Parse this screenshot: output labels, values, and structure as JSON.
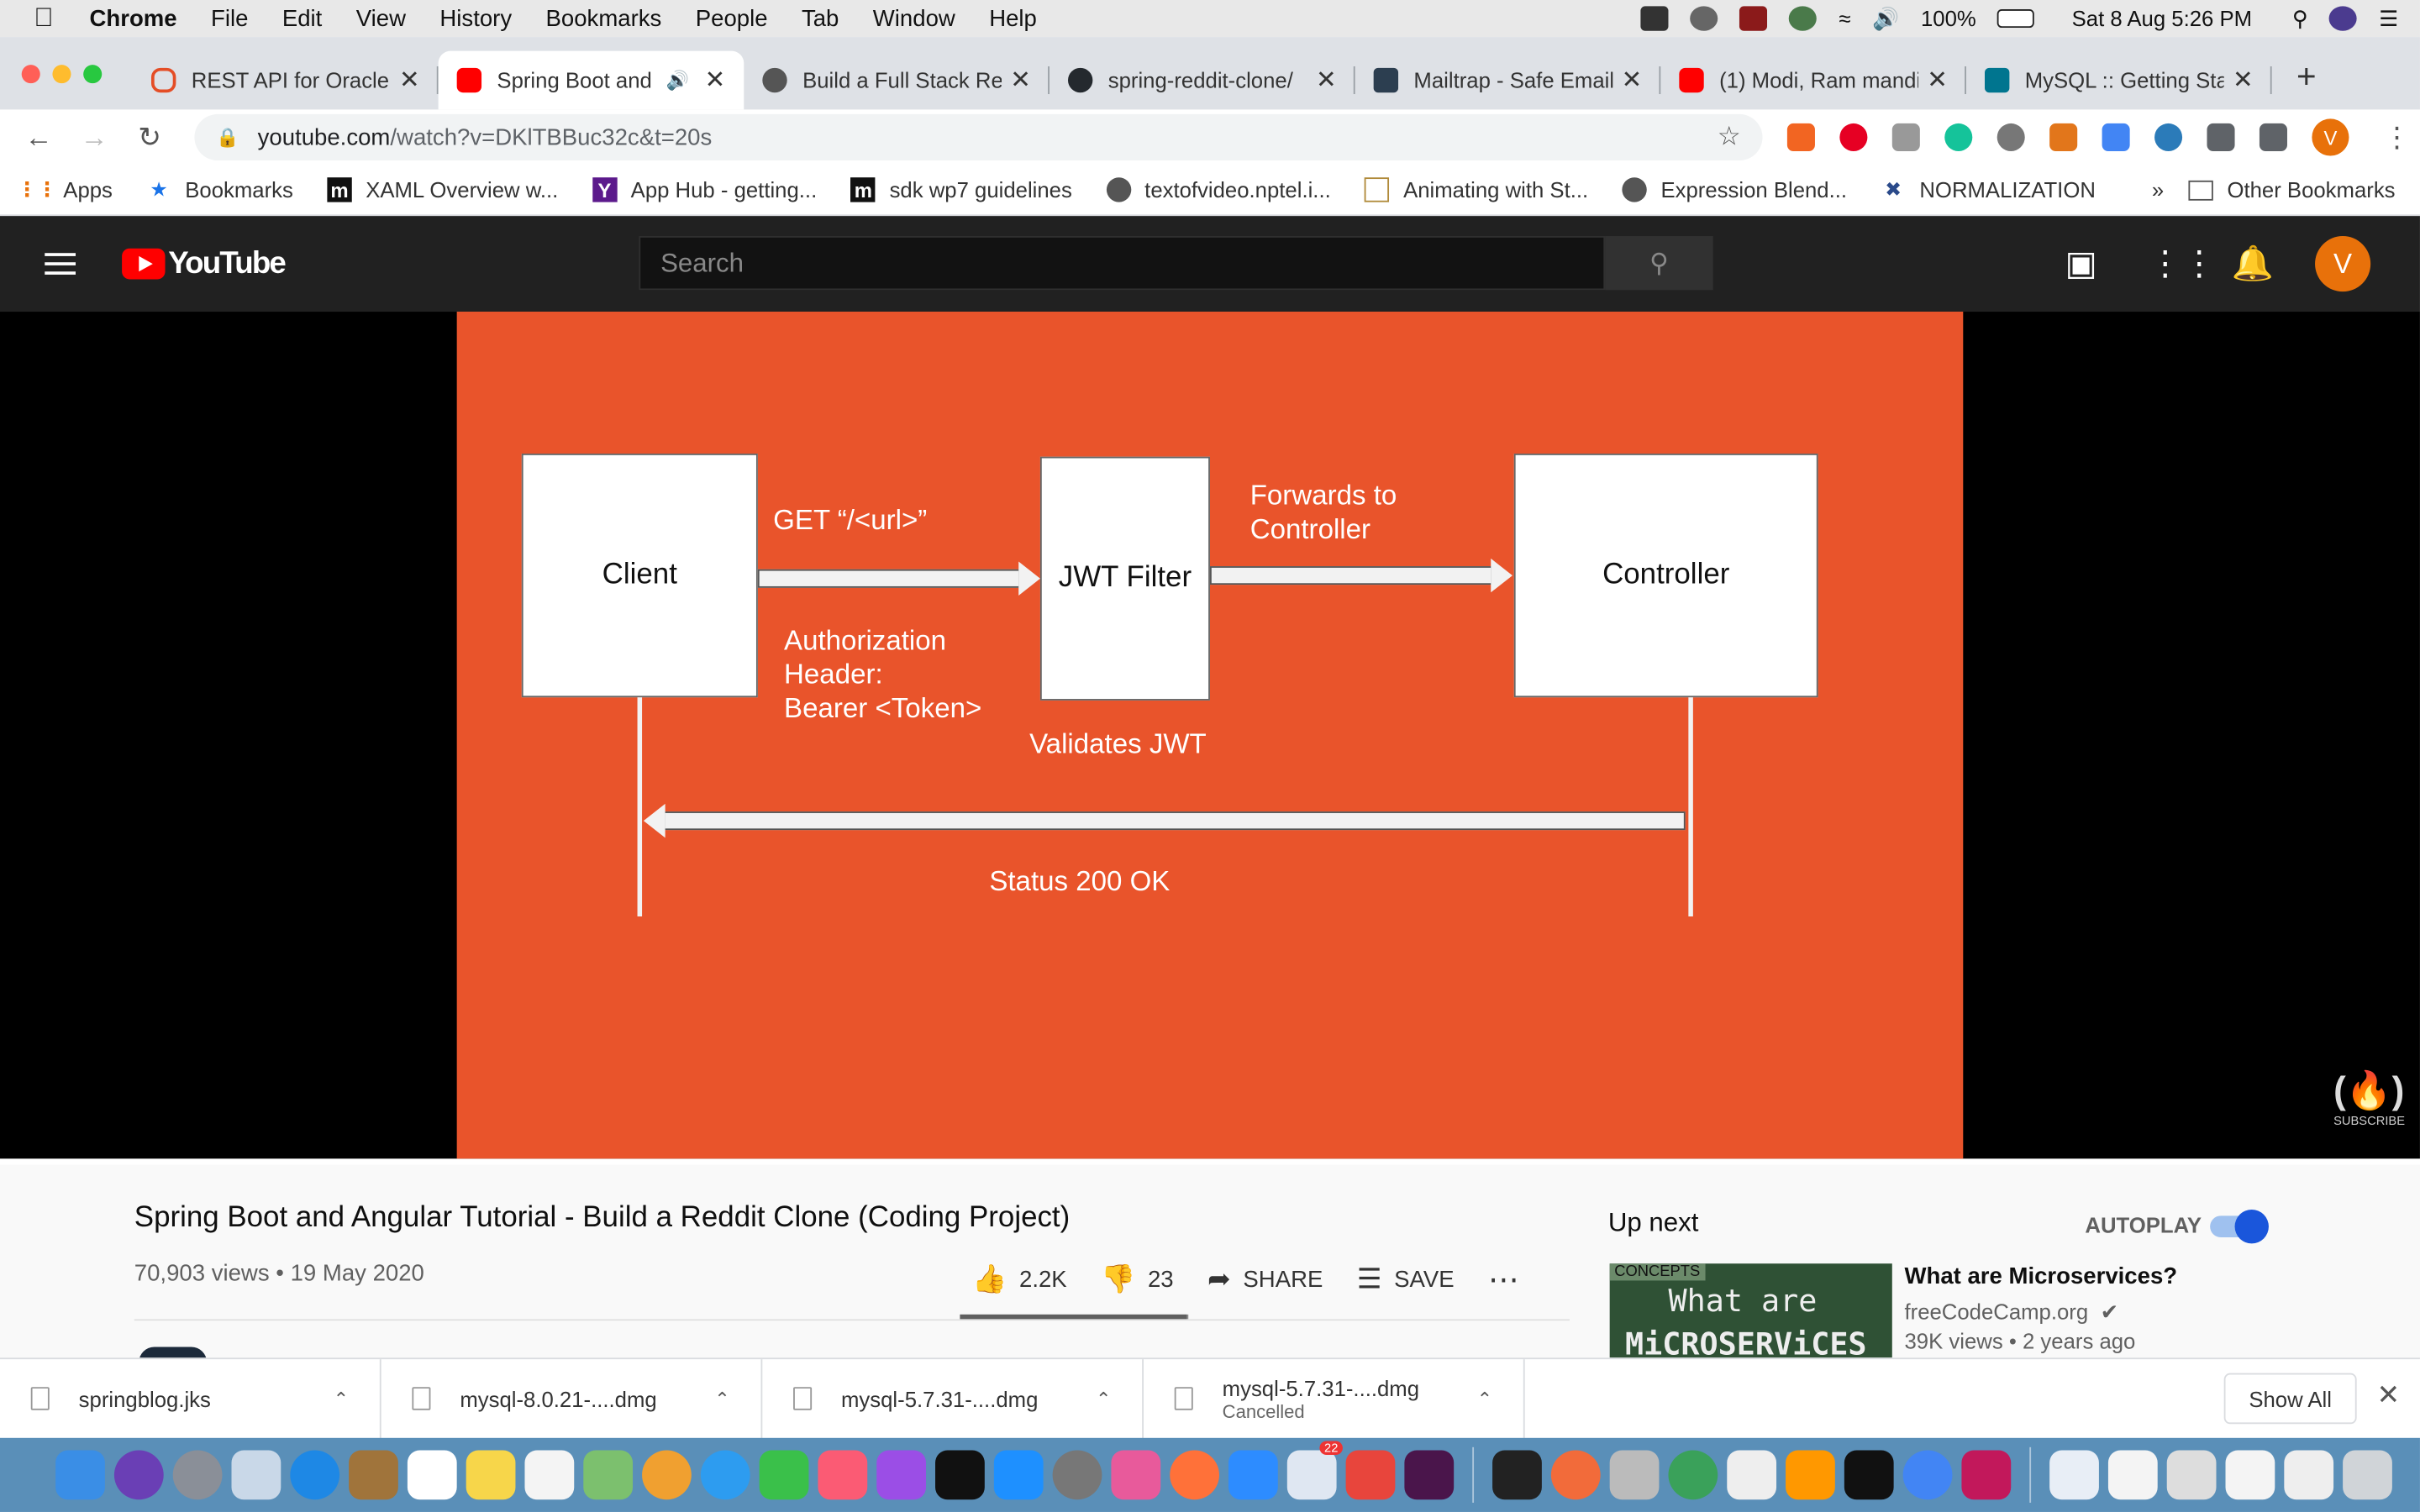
{
  "menubar": {
    "app": "Chrome",
    "items": [
      "File",
      "Edit",
      "View",
      "History",
      "Bookmarks",
      "People",
      "Tab",
      "Window",
      "Help"
    ],
    "battery": "100%",
    "datetime": "Sat 8 Aug  5:26 PM"
  },
  "tabs": [
    {
      "title": "REST API for Oracle",
      "favicon_color": "#e44d26",
      "active": false
    },
    {
      "title": "Spring Boot and",
      "favicon_color": "#ff0000",
      "active": true
    },
    {
      "title": "Build a Full Stack Re",
      "favicon_color": "#555555",
      "active": false
    },
    {
      "title": "spring-reddit-clone/",
      "favicon_color": "#24292e",
      "active": false
    },
    {
      "title": "Mailtrap - Safe Email",
      "favicon_color": "#2c3e50",
      "active": false
    },
    {
      "title": "(1) Modi, Ram mandi",
      "favicon_color": "#ff0000",
      "active": false
    },
    {
      "title": "MySQL :: Getting Sta",
      "favicon_color": "#00758f",
      "active": false
    }
  ],
  "address": {
    "host": "youtube.com",
    "path": "/watch?v=DKlTBBuc32c&t=20s"
  },
  "bookmarks": [
    {
      "label": "Apps",
      "icon": "apps-grid-icon"
    },
    {
      "label": "Bookmarks",
      "icon": "star-icon"
    },
    {
      "label": "XAML Overview w...",
      "icon": "m-icon"
    },
    {
      "label": "App Hub - getting...",
      "icon": "y-icon"
    },
    {
      "label": "sdk wp7 guidelines",
      "icon": "m-icon"
    },
    {
      "label": "textofvideo.nptel.i...",
      "icon": "globe-icon"
    },
    {
      "label": "Animating with St...",
      "icon": "bookmark-page-icon"
    },
    {
      "label": "Expression Blend...",
      "icon": "globe-icon"
    },
    {
      "label": "NORMALIZATION",
      "icon": "x-icon"
    }
  ],
  "bookmarks_more": "»",
  "bookmarks_other": "Other Bookmarks",
  "youtube": {
    "logo_text": "YouTube",
    "search_placeholder": "Search",
    "avatar_letter": "V"
  },
  "slide": {
    "client": "Client",
    "jwt_filter": "JWT Filter",
    "controller": "Controller",
    "get_label": "GET “/<url>”",
    "auth_label_1": "Authorization",
    "auth_label_2": "Header:",
    "auth_label_3": "Bearer <Token>",
    "forwards_1": "Forwards to",
    "forwards_2": "Controller",
    "validates": "Validates JWT",
    "status": "Status 200 OK",
    "subscribe": "SUBSCRIBE"
  },
  "video": {
    "title": "Spring Boot and Angular Tutorial - Build a Reddit Clone (Coding Project)",
    "views": "70,903 views",
    "date": "19 May 2020",
    "likes": "2.2K",
    "dislikes": "23",
    "share": "SHARE",
    "save": "SAVE",
    "like_ratio": 0.99
  },
  "upnext": {
    "heading": "Up next",
    "autoplay": "AUTOPLAY",
    "autoplay_on": true,
    "thumb_tag": "CONCEPTS",
    "thumb_line1": "What are",
    "thumb_line2": "MiCROSERViCES",
    "title": "What are Microservices?",
    "channel": "freeCodeCamp.org",
    "meta": "39K views • 2 years ago"
  },
  "downloads": [
    {
      "name": "springblog.jks",
      "status": ""
    },
    {
      "name": "mysql-8.0.21-....dmg",
      "status": ""
    },
    {
      "name": "mysql-5.7.31-....dmg",
      "status": ""
    },
    {
      "name": "mysql-5.7.31-....dmg",
      "status": "Cancelled"
    }
  ],
  "show_all": "Show All",
  "dock_badge": "22"
}
